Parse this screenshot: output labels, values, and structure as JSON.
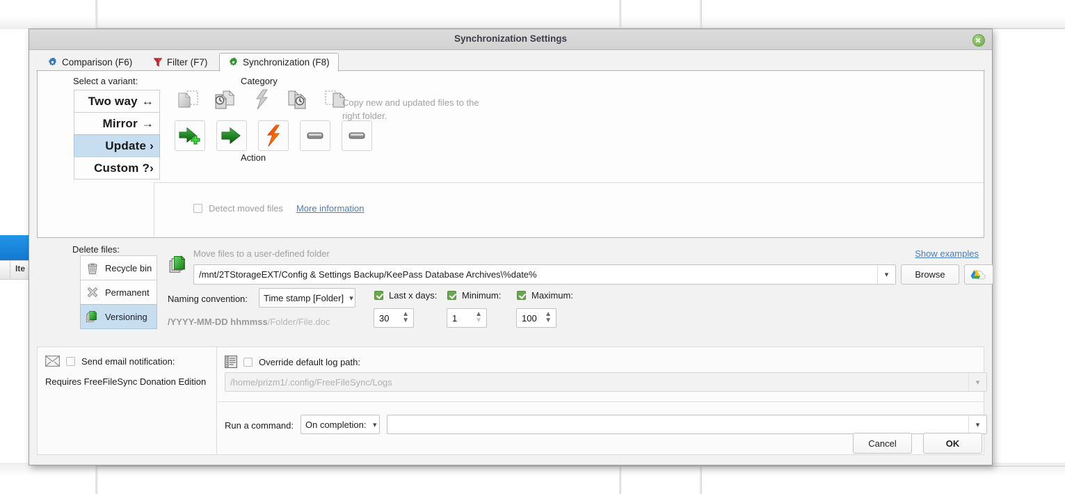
{
  "window": {
    "title": "Synchronization Settings",
    "close_icon": "close-icon"
  },
  "tabs": [
    {
      "label": "Comparison (F6)",
      "icon": "gear-blue-icon",
      "active": false
    },
    {
      "label": "Filter (F7)",
      "icon": "funnel-red-icon",
      "active": false
    },
    {
      "label": "Synchronization (F8)",
      "icon": "gear-green-icon",
      "active": true
    }
  ],
  "variant_panel": {
    "select_label": "Select a variant:",
    "variants": [
      {
        "label": "Two way",
        "glyph": "↔",
        "selected": false
      },
      {
        "label": "Mirror",
        "glyph": "→",
        "selected": false
      },
      {
        "label": "Update",
        "glyph": "›",
        "selected": true
      },
      {
        "label": "Custom",
        "glyph": "?›",
        "selected": false
      }
    ],
    "category_label": "Category",
    "action_label": "Action",
    "category_icons": [
      "file-new-left-icon",
      "file-updated-left-icon",
      "file-conflict-icon",
      "file-updated-right-icon",
      "file-new-right-icon"
    ],
    "action_icons": [
      "arrow-right-plus-icon",
      "arrow-right-icon",
      "lightning-conflict-icon",
      "do-nothing-icon",
      "do-nothing-icon"
    ],
    "description": "Copy new and updated files to the right folder.",
    "detect_moved_label": "Detect moved files",
    "detect_moved_checked": false,
    "more_information_label": "More information"
  },
  "delete_files": {
    "label": "Delete files:",
    "options": [
      {
        "label": "Recycle bin",
        "icon": "trash-icon",
        "selected": false
      },
      {
        "label": "Permanent",
        "icon": "x-mark-icon",
        "selected": false
      },
      {
        "label": "Versioning",
        "icon": "versioning-stack-icon",
        "selected": true
      }
    ]
  },
  "versioning": {
    "icon": "versioning-stack-icon",
    "move_label": "Move files to a user-defined folder",
    "show_examples_label": "Show examples",
    "path_value": "/mnt/2TStorageEXT/Config & Settings Backup/KeePass Database Archives\\%date%",
    "browse_label": "Browse",
    "cloud_button_icon": "cloud-drive-icon",
    "naming_label": "Naming convention:",
    "naming_value": "Time stamp [Folder]",
    "pattern_bold": "/YYYY-MM-DD hhmmss",
    "pattern_rest": "/Folder/File.doc",
    "limits": [
      {
        "label": "Last x days:",
        "checked": true,
        "value": "30"
      },
      {
        "label": "Minimum:",
        "checked": true,
        "value": "1"
      },
      {
        "label": "Maximum:",
        "checked": true,
        "value": "100"
      }
    ]
  },
  "email": {
    "icon": "envelope-icon",
    "label": "Send email notification:",
    "checked": false,
    "note": "Requires FreeFileSync Donation Edition"
  },
  "log": {
    "icon": "log-list-icon",
    "label": "Override default log path:",
    "checked": false,
    "path_placeholder": "/home/prizm1/.config/FreeFileSync/Logs"
  },
  "command": {
    "label": "Run a command:",
    "trigger_value": "On completion:",
    "value": ""
  },
  "footer": {
    "cancel_label": "Cancel",
    "ok_label": "OK"
  },
  "background": {
    "column_header": "Ite"
  },
  "colors": {
    "selection_blue": "#c7ddf0",
    "link_blue": "#4a7ebb",
    "check_green": "#6aa84f",
    "titlebar": "#d7d7d7"
  }
}
